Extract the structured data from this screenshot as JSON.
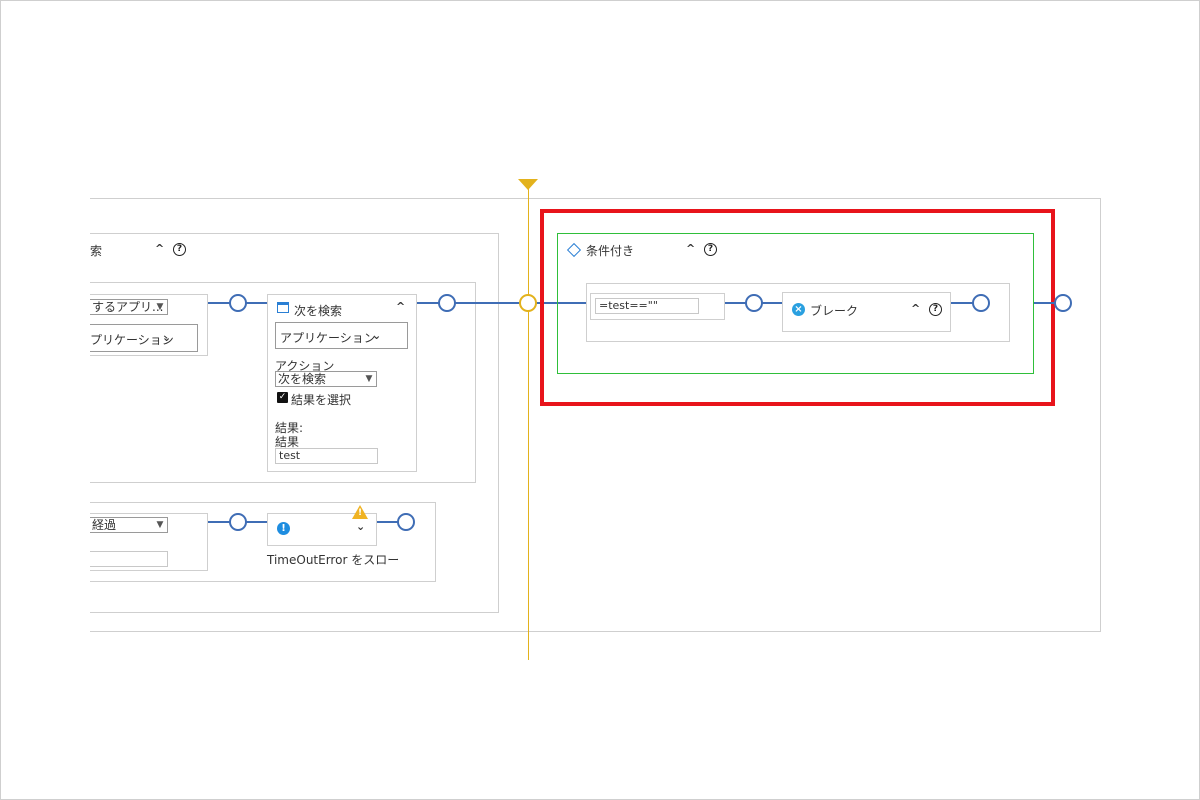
{
  "left_panel": {
    "partial_title": "索",
    "app_select_partial": "するアプリ...",
    "app_dropdown_partial": "プリケーション",
    "time_select_partial": "経過"
  },
  "find_next": {
    "title": "次を検索",
    "application": "アプリケーション",
    "action_label": "アクション",
    "action_value": "次を検索",
    "select_result_label": "結果を選択",
    "result_heading": "結果:",
    "result_label": "結果",
    "result_value": "test"
  },
  "timeout": {
    "label": "TimeOutError をスロー"
  },
  "conditional": {
    "title": "条件付き",
    "condition_value": "=test==\"\"",
    "break_label": "ブレーク"
  },
  "colors": {
    "connector": "#3f6db5",
    "playhead": "#e3b21c",
    "highlight": "#e8141b",
    "conditional_border": "#2fbf3a",
    "break_icon": "#2aa0e0",
    "info_icon": "#1e8de0",
    "warning": "#f0b323"
  },
  "icons": {
    "conditional": "diamond-icon",
    "break": "close-circle-icon",
    "info": "info-icon",
    "warning": "warning-icon",
    "window": "window-icon",
    "help": "help-icon",
    "collapse": "chevron-up-icon",
    "expand": "chevron-down-icon"
  }
}
